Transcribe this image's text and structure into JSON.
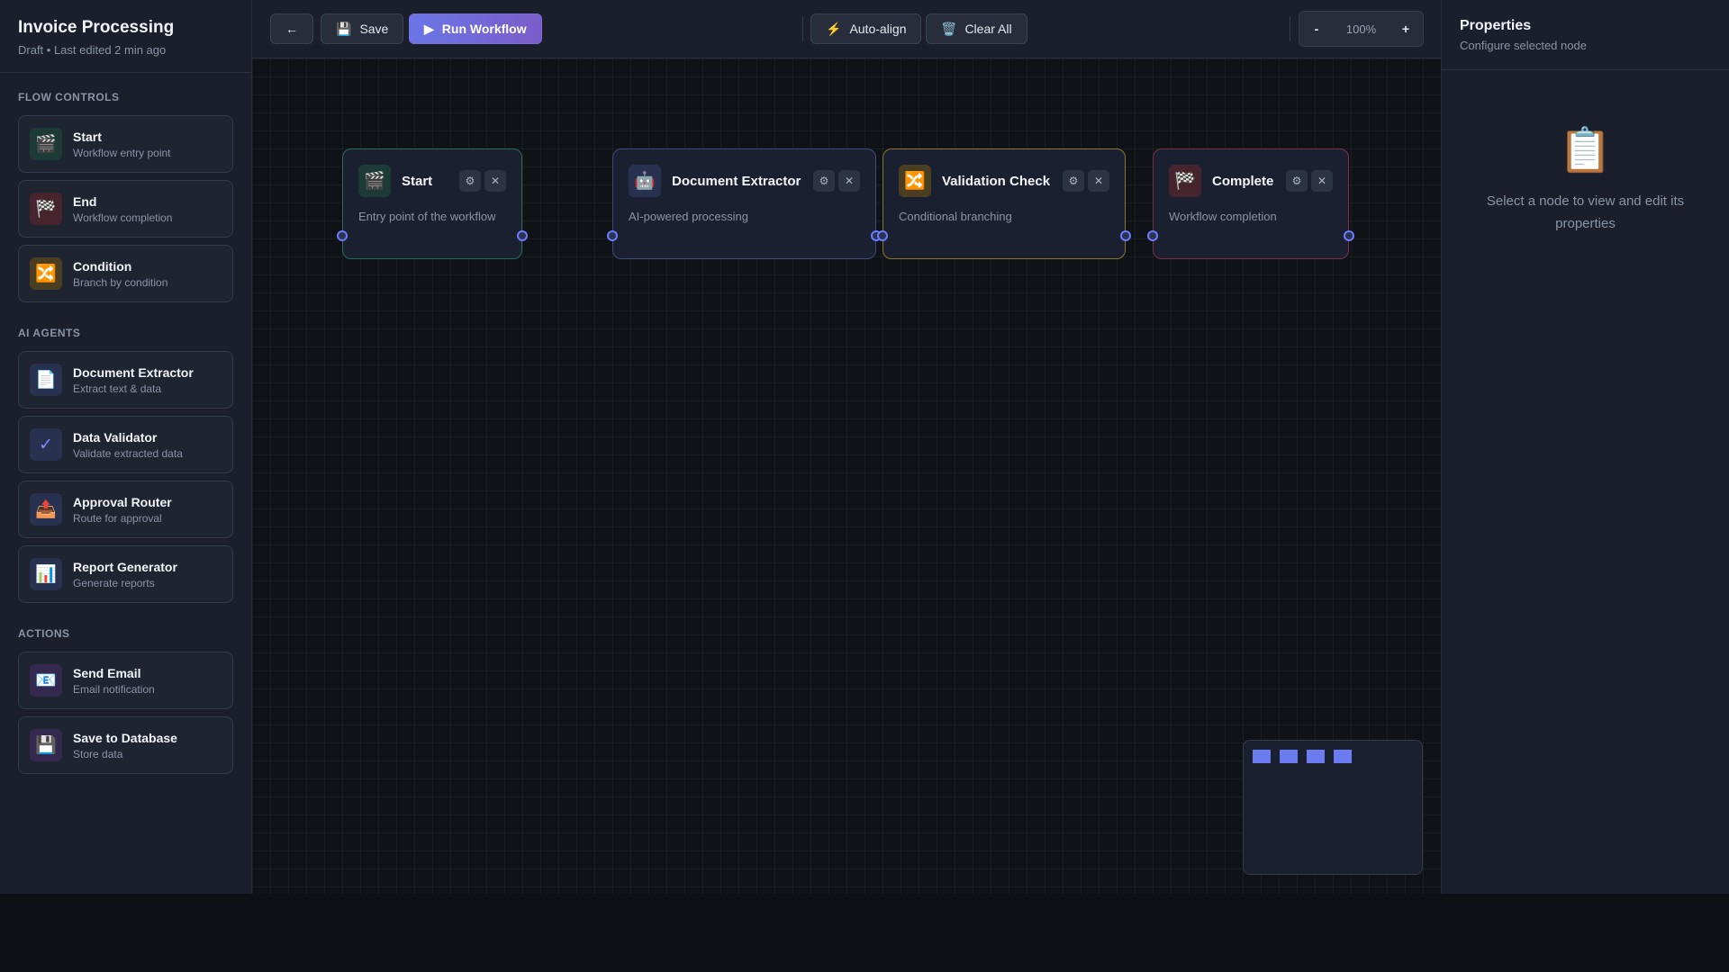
{
  "workflow": {
    "title": "Invoice Processing",
    "subtitle": "Draft • Last edited 2 min ago"
  },
  "palette": {
    "sections": [
      {
        "title": "Flow Controls",
        "items": [
          {
            "name": "Start",
            "desc": "Workflow entry point",
            "icon": "clapper-icon",
            "glyph": "🎬"
          },
          {
            "name": "End",
            "desc": "Workflow completion",
            "icon": "checkered-flag-icon",
            "glyph": "🏁"
          },
          {
            "name": "Condition",
            "desc": "Branch by condition",
            "icon": "shuffle-icon",
            "glyph": "🔀"
          }
        ]
      },
      {
        "title": "AI Agents",
        "items": [
          {
            "name": "Document Extractor",
            "desc": "Extract text & data",
            "icon": "document-icon",
            "glyph": "📄"
          },
          {
            "name": "Data Validator",
            "desc": "Validate extracted data",
            "icon": "checkmark-icon",
            "glyph": "✓"
          },
          {
            "name": "Approval Router",
            "desc": "Route for approval",
            "icon": "outbox-icon",
            "glyph": "📤"
          },
          {
            "name": "Report Generator",
            "desc": "Generate reports",
            "icon": "bar-chart-icon",
            "glyph": "📊"
          }
        ]
      },
      {
        "title": "Actions",
        "items": [
          {
            "name": "Send Email",
            "desc": "Email notification",
            "icon": "email-icon",
            "glyph": "📧"
          },
          {
            "name": "Save to Database",
            "desc": "Store data",
            "icon": "floppy-disk-icon",
            "glyph": "💾"
          }
        ]
      }
    ]
  },
  "toolbar": {
    "back_label": "←",
    "save_label": "Save",
    "save_glyph": "💾",
    "run_label": "Run Workflow",
    "run_glyph": "▶",
    "autoalign_label": "Auto-align",
    "autoalign_glyph": "⚡",
    "clear_label": "Clear All",
    "clear_glyph": "🗑️",
    "zoom_out": "-",
    "zoom_in": "+",
    "zoom_level": "100%"
  },
  "canvas": {
    "nodes": [
      {
        "title": "Start",
        "desc": "Entry point of the workflow",
        "glyph": "🎬",
        "icon": "clapper-icon"
      },
      {
        "title": "Document Extractor",
        "desc": "AI-powered processing",
        "glyph": "🤖",
        "icon": "robot-icon"
      },
      {
        "title": "Validation Check",
        "desc": "Conditional branching",
        "glyph": "🔀",
        "icon": "shuffle-icon"
      },
      {
        "title": "Complete",
        "desc": "Workflow completion",
        "glyph": "🏁",
        "icon": "checkered-flag-icon"
      }
    ],
    "node_settings_glyph": "⚙",
    "node_close_glyph": "✕"
  },
  "properties": {
    "title": "Properties",
    "subtitle": "Configure selected node",
    "empty_glyph": "📋",
    "empty_text": "Select a node to view and edit its properties"
  },
  "colors": {
    "accent": "#6b7cff",
    "run_gradient_start": "#6a76e6",
    "run_gradient_end": "#7b5cc9",
    "start_border": "#2a6b5c",
    "extractor_border": "#414a80",
    "validation_border": "#8a7532",
    "complete_border": "#7a3242"
  }
}
